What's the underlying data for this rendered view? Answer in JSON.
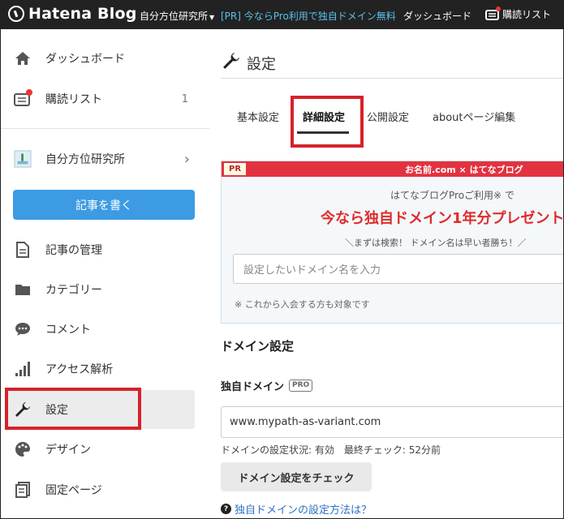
{
  "topbar": {
    "logo_text": "Hatena Blog",
    "blog_selector": "自分方位研究所",
    "pr_link": "[PR] 今ならPro利用で独自ドメイン無料",
    "dashboard": "ダッシュボード",
    "subscriptions": "購読リスト"
  },
  "sidebar": {
    "items": [
      {
        "label": "ダッシュボード",
        "icon": "home-icon"
      },
      {
        "label": "購読リスト",
        "icon": "mail-icon",
        "count": "1"
      },
      {
        "label": "自分方位研究所",
        "icon": "blog-thumbnail-icon"
      },
      {
        "label": "記事の管理",
        "icon": "document-icon"
      },
      {
        "label": "カテゴリー",
        "icon": "folder-icon"
      },
      {
        "label": "コメント",
        "icon": "comment-icon"
      },
      {
        "label": "アクセス解析",
        "icon": "bar-chart-icon"
      },
      {
        "label": "設定",
        "icon": "wrench-icon"
      },
      {
        "label": "デザイン",
        "icon": "palette-icon"
      },
      {
        "label": "固定ページ",
        "icon": "page-icon"
      }
    ],
    "write_button": "記事を書く"
  },
  "main": {
    "title": "設定",
    "tabs": [
      {
        "label": "基本設定"
      },
      {
        "label": "詳細設定",
        "active": true
      },
      {
        "label": "公開設定"
      },
      {
        "label": "aboutページ編集"
      }
    ],
    "pr_box": {
      "tag": "PR",
      "brand": "お名前.com × はてなブログ",
      "line1": "はてなブログProご利用※ で",
      "line2": "今なら独自ドメイン1年分プレゼント",
      "line3": "＼まずは検索！ ドメイン名は早い者勝ち！／",
      "input_placeholder": "設定したいドメイン名を入力",
      "note": "※ これから入会する方も対象です"
    },
    "domain": {
      "section_title": "ドメイン設定",
      "field_label": "独自ドメイン",
      "pro_badge": "PRO",
      "value": "www.mypath-as-variant.com",
      "status": "ドメインの設定状況: 有効　最終チェック: 52分前",
      "check_button": "ドメイン設定をチェック",
      "help_link": "独自ドメインの設定方法は？"
    }
  },
  "colors": {
    "topbar_bg": "#222222",
    "accent_blue": "#3c9be3",
    "highlight_red": "#d6212b",
    "pr_red": "#e02b2b"
  }
}
